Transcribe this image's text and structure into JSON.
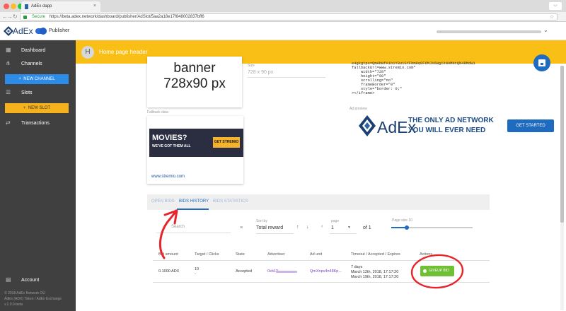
{
  "browser": {
    "tab_title": "AdEx dapp",
    "tab_close": "×",
    "user_icon": "◡",
    "back": "←",
    "forward": "→",
    "reload": "↻",
    "secure_label": "Secure",
    "url": "https://beta.adex.network/dashboard/publisher/AdSlot/5aa2a18e17f848002837bff6",
    "star": "☆"
  },
  "appbar": {
    "brand": "AdEx",
    "mode_label": "Publisher",
    "menu_chevron": "⌄"
  },
  "sidebar": {
    "items": [
      {
        "label": "Dashboard",
        "icon": "dashboard-icon",
        "glyph": "▦"
      },
      {
        "label": "Channels",
        "icon": "channels-icon",
        "glyph": "⋔"
      },
      {
        "label": "Slots",
        "icon": "slots-icon",
        "glyph": "☰"
      },
      {
        "label": "Transactions",
        "icon": "transactions-icon",
        "glyph": "⇄"
      },
      {
        "label": "Account",
        "icon": "account-icon",
        "glyph": "▤"
      }
    ],
    "new_channel": "NEW CHANNEL",
    "new_slot": "NEW SLOT",
    "plus": "+",
    "footer": [
      "© 2018 AdEx Network OÜ",
      "AdEx (ADX) Token / AdEx Exchange",
      "v.1.0.0-beta"
    ]
  },
  "header": {
    "avatar_letter": "H",
    "title": "Home page header"
  },
  "slot": {
    "banner_line1": "banner",
    "banner_line2": "728x90 px",
    "size_label": "Size",
    "size_value": "728 x 90 px",
    "embed_code": "e4gkgtps=QmAbWfA1b1Y8u1GYFbm8q0F6MJX6Wg1kN4MNtQN4RMdW1\nfallbackUrl=www.stremio.com\"\n    width=\"728\"\n    height=\"90\"\n    scrolling=\"no\"\n    frameBorder=\"0\"\n    style=\"border: 0;\"\n></iframe>",
    "fallback_label": "Fallback data",
    "fallback_banner": {
      "title": "MOVIES?",
      "subtitle": "WE'VE GOT THEM ALL",
      "button": "GET STREMIO"
    },
    "fallback_url": "www.stremio.com",
    "ad_preview_label": "Ad preview",
    "preview_brand": "AdEx",
    "preview_tagline1": "THE ONLY AD NETWORK",
    "preview_tagline2": "YOU WILL EVER NEED",
    "get_started": "GET STARTED"
  },
  "bids": {
    "tabs": [
      "OPEN BIDS",
      "BIDS HISTORY",
      "BIDS STATISTICS"
    ],
    "active_tab": "BIDS HISTORY",
    "search_placeholder": "Search",
    "sort_label": "Sort by",
    "sort_value": "Total reward",
    "page_label": "page",
    "page_value": "1",
    "page_of": "of 1",
    "page_size_label": "Page size 10",
    "page_size": 10,
    "columns": [
      "Bid amount",
      "Target / Clicks",
      "State",
      "Advertiser",
      "Ad unit",
      "Timeout / Accepted / Expires",
      "Actions"
    ],
    "row": {
      "amount": "0.1000 ADX",
      "target": "10",
      "clicks": "-",
      "state": "Accepted",
      "advertiser": "0xb13",
      "ad_unit": "QmXnpv4n48Kp...",
      "timeout": "7 days",
      "accepted": "March 12th, 2018, 17:17:20",
      "expires": "March 19th, 2018, 17:17:20",
      "action": "GIVEUP BID"
    }
  },
  "colors": {
    "accent": "#1f6bbf",
    "header": "#f9bf17",
    "sidebar": "#404040",
    "annotation": "#e8242a",
    "giveup": "#70c035"
  }
}
